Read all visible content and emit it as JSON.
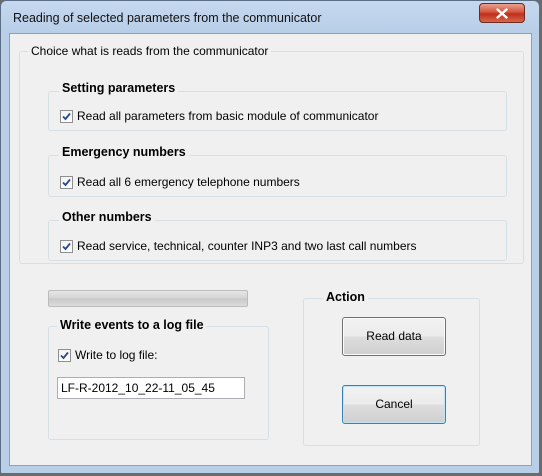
{
  "window": {
    "title": "Reading of selected parameters from the communicator"
  },
  "main_group": {
    "legend": "Choice what is reads from the communicator"
  },
  "setting_parameters": {
    "legend": "Setting parameters",
    "checkbox_label": "Read all parameters from basic module of communicator",
    "checked": true
  },
  "emergency_numbers": {
    "legend": "Emergency numbers",
    "checkbox_label": "Read all 6 emergency telephone numbers",
    "checked": true
  },
  "other_numbers": {
    "legend": "Other numbers",
    "checkbox_label": "Read service, technical, counter INP3 and two last call numbers",
    "checked": true
  },
  "progress": {
    "value": 0
  },
  "log_group": {
    "legend": "Write events to a log file",
    "checkbox_label": "Write to log file:",
    "checked": true,
    "filename": "LF-R-2012_10_22-11_05_45"
  },
  "action_group": {
    "legend": "Action",
    "read_label": "Read data",
    "cancel_label": "Cancel"
  },
  "colors": {
    "title_bar": "#b9cfe8",
    "close_button": "#c0301b",
    "client_bg": "#f0f0f0"
  }
}
